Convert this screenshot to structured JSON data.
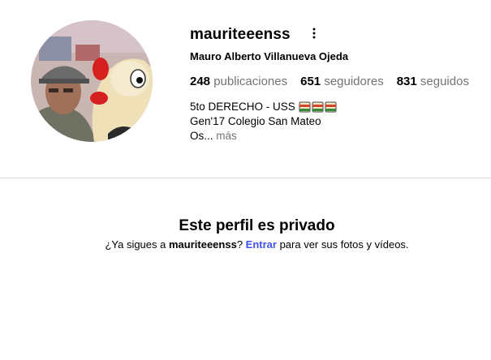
{
  "profile": {
    "username": "mauriteeenss",
    "full_name": "Mauro Alberto Villanueva Ojeda",
    "more_options_icon": "more-vertical-icon",
    "avatar_icon": "profile-photo"
  },
  "stats": [
    {
      "count": "248",
      "label": "publicaciones"
    },
    {
      "count": "651",
      "label": "seguidores"
    },
    {
      "count": "831",
      "label": "seguidos"
    }
  ],
  "bio": {
    "line1": "5to DERECHO - USS",
    "line1_emojis": "books-icon",
    "line2": "Gen'17 Colegio San Mateo",
    "line3": "Os...",
    "more": "más"
  },
  "private": {
    "title": "Este perfil es privado",
    "msg_prefix": "¿Ya sigues a ",
    "msg_username": "mauriteeenss",
    "msg_mid": "? ",
    "login_label": "Entrar",
    "msg_suffix": " para ver sus fotos y vídeos."
  },
  "colors": {
    "secondary_text": "#737373",
    "link": "#4150f7",
    "divider": "#dbdbdb"
  }
}
